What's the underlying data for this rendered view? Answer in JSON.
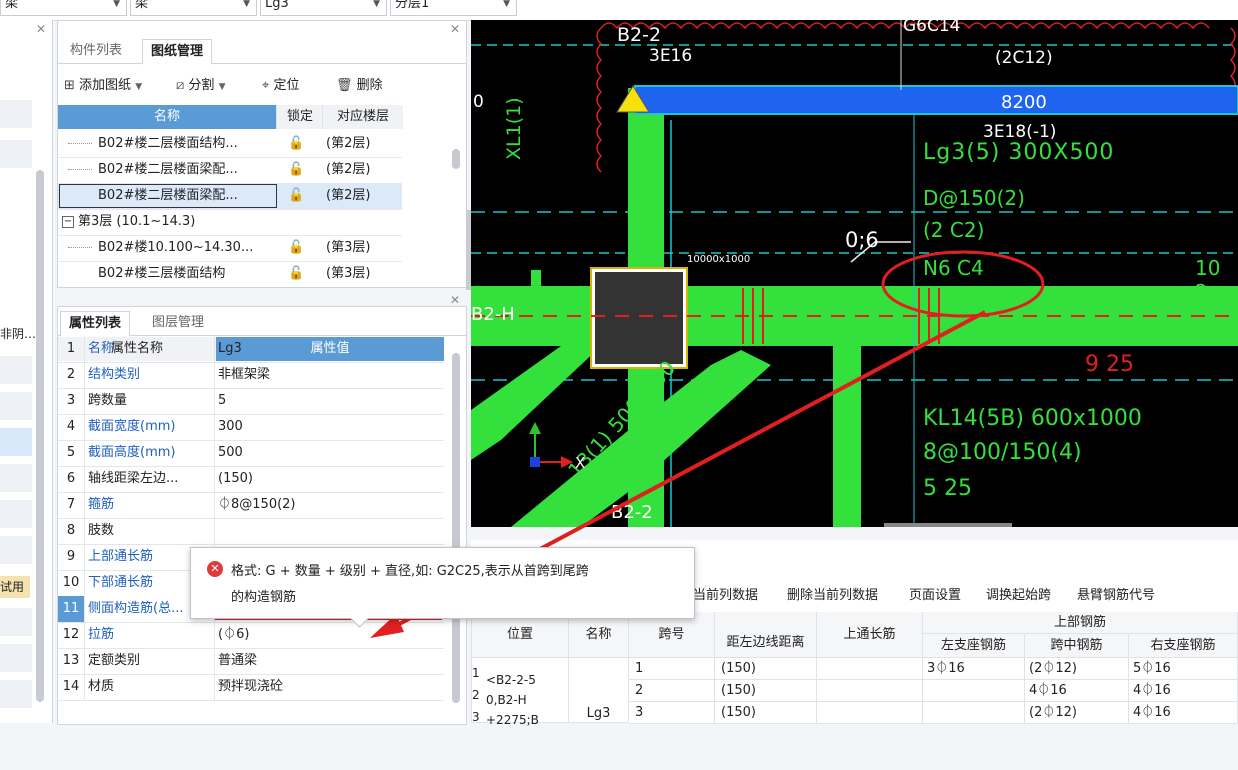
{
  "top_combos": [
    "梁",
    "梁",
    "Lg3",
    "分层1"
  ],
  "left_panel": {
    "truncated_label": "非阴…",
    "test_label": "试用"
  },
  "upper_panel": {
    "tabs": [
      "构件列表",
      "图纸管理"
    ],
    "toolbar": [
      "添加图纸",
      "分割",
      "定位",
      "删除"
    ],
    "columns": [
      "名称",
      "锁定",
      "对应楼层"
    ],
    "rows": [
      {
        "name": "B02#楼二层楼面结构...",
        "floor": "(第2层)"
      },
      {
        "name": "B02#楼二层楼面梁配...",
        "floor": "(第2层)"
      },
      {
        "name": "B02#楼二层楼面梁配...",
        "floor": "(第2层)"
      },
      {
        "name": "第3层 (10.1~14.3)",
        "floor": ""
      },
      {
        "name": "B02#楼10.100~14.30...",
        "floor": "(第3层)"
      },
      {
        "name": "B02#楼三层楼面结构",
        "floor": "(第3层)"
      }
    ]
  },
  "props_panel": {
    "tabs": [
      "属性列表",
      "图层管理"
    ],
    "col_name": "属性名称",
    "col_value": "属性值",
    "rows": [
      {
        "n": "1",
        "name": "名称",
        "value": "Lg3"
      },
      {
        "n": "2",
        "name": "结构类别",
        "value": "非框架梁"
      },
      {
        "n": "3",
        "name": "跨数量",
        "value": "5"
      },
      {
        "n": "4",
        "name": "截面宽度(mm)",
        "value": "300"
      },
      {
        "n": "5",
        "name": "截面高度(mm)",
        "value": "500"
      },
      {
        "n": "6",
        "name": "轴线距梁左边...",
        "value": "(150)"
      },
      {
        "n": "7",
        "name": "箍筋",
        "value": "⏀8@150(2)"
      },
      {
        "n": "8",
        "name": "肢数",
        "value": ""
      },
      {
        "n": "9",
        "name": "上部通长筋",
        "value": ""
      },
      {
        "n": "10",
        "name": "下部通长筋",
        "value": ""
      },
      {
        "n": "11",
        "name": "侧面构造筋(总...",
        "value": "N6C14"
      },
      {
        "n": "12",
        "name": "拉筋",
        "value": "(⏀6)"
      },
      {
        "n": "13",
        "name": "定额类别",
        "value": "普通梁"
      },
      {
        "n": "14",
        "name": "材质",
        "value": "预拌现浇砼"
      }
    ]
  },
  "tooltip": {
    "line1": "格式: G + 数量 + 级别 + 直径,如: G2C25,表示从首跨到尾跨",
    "line2": "的构造钢筋"
  },
  "cad": {
    "labels": {
      "b22_top": "B2-2",
      "e16": "3E16",
      "g6c14": "G6C14",
      "c12": "(2C12)",
      "dim8200": "8200",
      "zero": "0",
      "e18": "3E18(-1)",
      "lg3": "Lg3(5) 300X500",
      "stirrup": "D@150(2)",
      "c2": "(2 C2)",
      "n6c4": "N6 C4",
      "dim06": "0;6",
      "b2h": "B2-H",
      "b22_bot": "B2-2",
      "e925": "9 25",
      "kl14": "KL14(5B) 600x1000",
      "kl14_2": "8@100/150(4)",
      "kl14_3": "5 25",
      "xl": "XL1(1)",
      "tiny": "10000x1000",
      "beam500": "13(1) 500x800",
      "axis_x": "X",
      "right_num": "10 2"
    }
  },
  "bottom_table": {
    "toolbar": [
      "当前列数据",
      "删除当前列数据",
      "页面设置",
      "调换起始跨",
      "悬臂钢筋代号"
    ],
    "h_pos": "位置",
    "h_name": "名称",
    "h_span": "跨号",
    "h_left": "距左边线距离",
    "h_top": "上通长筋",
    "h_group": "上部钢筋",
    "h_ls": "左支座钢筋",
    "h_mid": "跨中钢筋",
    "h_rs": "右支座钢筋",
    "pos_text": "<B2-2-5\n0,B2-H\n+2275;B",
    "name_text": "Lg3",
    "rows": [
      {
        "idx": "1",
        "span": "1",
        "left": "(150)",
        "ls": "3⏀16",
        "mid": "(2⏀12)",
        "rs": "5⏀16"
      },
      {
        "idx": "2",
        "span": "2",
        "left": "(150)",
        "ls": "",
        "mid": "4⏀16",
        "rs": "4⏀16"
      },
      {
        "idx": "3",
        "span": "3",
        "left": "(150)",
        "ls": "",
        "mid": "(2⏀12)",
        "rs": "4⏀16"
      }
    ]
  }
}
